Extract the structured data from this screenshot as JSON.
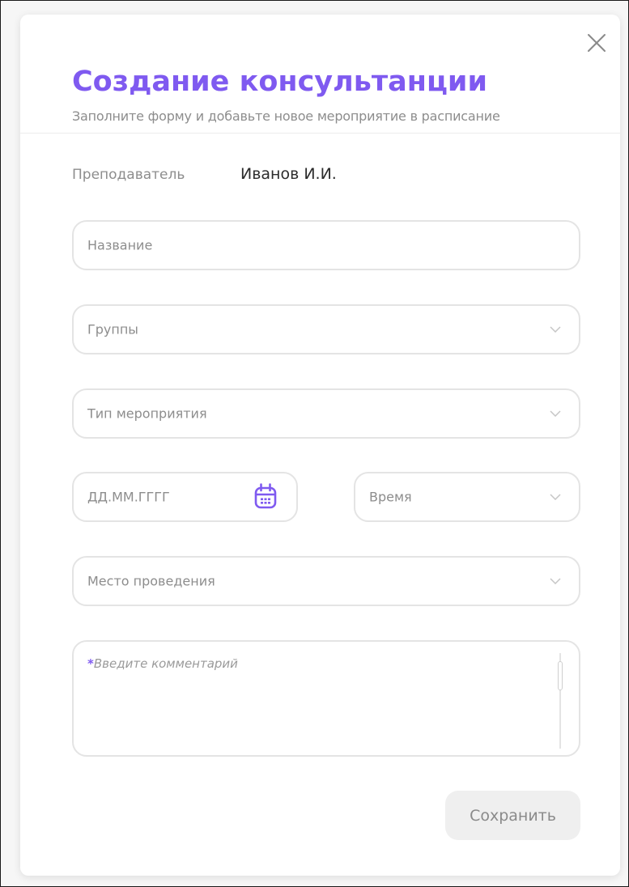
{
  "modal": {
    "title": "Создание консультанции",
    "subtitle": "Заполните форму и добавьте новое мероприятие в расписание"
  },
  "teacher": {
    "label": "Преподаватель",
    "value": "Иванов И.И."
  },
  "fields": {
    "name": {
      "placeholder": "Название"
    },
    "groups": {
      "placeholder": "Группы"
    },
    "event_type": {
      "placeholder": "Тип мероприятия"
    },
    "date": {
      "placeholder": "ДД.ММ.ГГГГ"
    },
    "time": {
      "placeholder": "Время"
    },
    "place": {
      "placeholder": "Место проведения"
    },
    "comment": {
      "required_mark": "*",
      "placeholder": "Введите комментарий"
    }
  },
  "actions": {
    "save_label": "Сохранить"
  },
  "icons": {
    "close": "close-icon",
    "dropdown": "chevron-down-icon",
    "calendar": "calendar-icon"
  },
  "colors": {
    "accent": "#7f5af0",
    "border": "#e4e4e4",
    "muted_text": "#8d8d8d",
    "button_bg": "#efefef"
  }
}
